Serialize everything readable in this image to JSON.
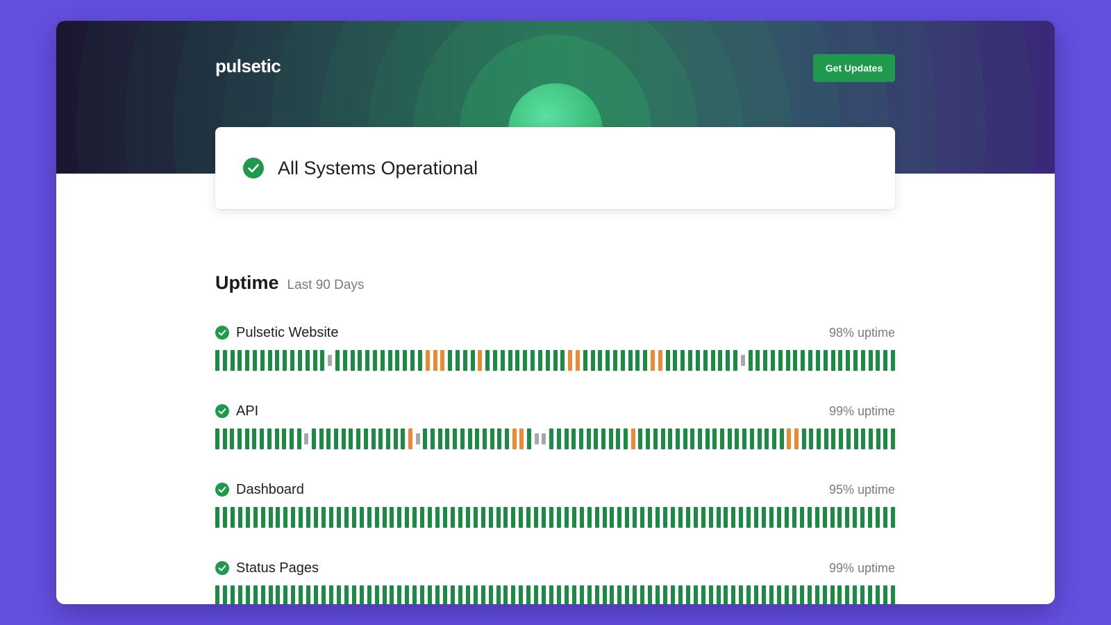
{
  "brand": {
    "name": "pulsetic"
  },
  "header": {
    "cta_label": "Get Updates"
  },
  "status": {
    "message": "All Systems Operational",
    "icon": "check-circle-icon"
  },
  "uptime": {
    "title": "Uptime",
    "subtitle": "Last 90 Days",
    "legend_colors": {
      "operational": "#1b8a43",
      "degraded": "#ea8a35",
      "no_data": "#a8a8ac"
    },
    "services": [
      {
        "name": "Pulsetic Website",
        "uptime_label": "98% uptime",
        "days": "uuuuuuuuuuuuuuunuuuuuuuuuuuuddduuuuduuuuuuuuuuudduuuuuuuuudduuuuuuuuuunuuuuuuuuuuuuuuuuuuuu"
      },
      {
        "name": "API",
        "uptime_label": "99% uptime",
        "days": "uuuuuuuuuuuunuuuuuuuuuuuuudnuuuuuuuuuuuuddunnuuuuuuuuuuuduuuuuuuuuuuuuuuuuuuudduuuuuuuuuuuuu"
      },
      {
        "name": "Dashboard",
        "uptime_label": "95% uptime",
        "days": "uuuuuuuuuuuuuuuuuuuuuuuuuuuuuuuuuuuuuuuuuuuuuuuuuuuuuuuuuuuuuuuuuuuuuuuuuuuuuuuuuuuuuuuuuu"
      },
      {
        "name": "Status Pages",
        "uptime_label": "99% uptime",
        "days": "uuuuuuuuuuuuuuuuuuuuuuuuuuuuuuuuuuuuuuuuuuuuuuuuuuuuuuuuuuuuuuuuuuuuuuuuuuuuuuuuuuuuuuuuuu"
      }
    ]
  }
}
